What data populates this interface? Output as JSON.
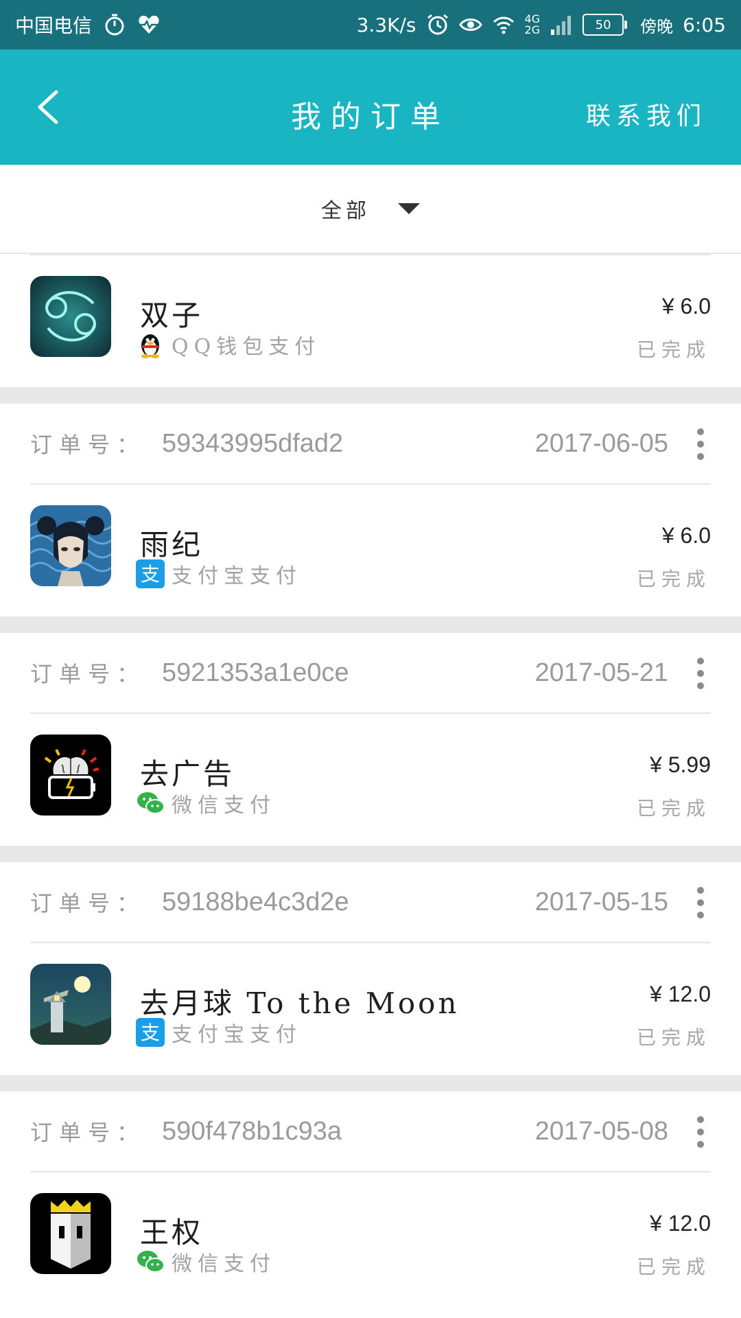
{
  "status_bar": {
    "carrier": "中国电信",
    "net_speed": "3.3K/s",
    "network_type_top": "4G",
    "network_type_bottom": "2G",
    "battery": "50",
    "time_prefix": "傍晚",
    "time": "6:05"
  },
  "app_bar": {
    "title": "我的订单",
    "contact_label": "联系我们"
  },
  "filter": {
    "label": "全部"
  },
  "order_number_label": "订单号：",
  "orders": [
    {
      "app_name": "双子",
      "payment_method": "QQ钱包支付",
      "price": "¥ 6.0",
      "status": "已完成",
      "icon": "twins-icon"
    },
    {
      "order_id": "59343995dfad2",
      "date": "2017-06-05",
      "app_name": "雨纪",
      "payment_method": "支付宝支付",
      "price": "¥ 6.0",
      "status": "已完成",
      "icon": "rain-icon"
    },
    {
      "order_id": "5921353a1e0ce",
      "date": "2017-05-21",
      "app_name": "去广告",
      "payment_method": "微信支付",
      "price": "¥ 5.99",
      "status": "已完成",
      "icon": "ad-remover-icon"
    },
    {
      "order_id": "59188be4c3d2e",
      "date": "2017-05-15",
      "app_name": "去月球 To the Moon",
      "payment_method": "支付宝支付",
      "price": "¥ 12.0",
      "status": "已完成",
      "icon": "moon-icon"
    },
    {
      "order_id": "590f478b1c93a",
      "date": "2017-05-08",
      "app_name": "王权",
      "payment_method": "微信支付",
      "price": "¥ 12.0",
      "status": "已完成",
      "icon": "crown-icon"
    }
  ],
  "colors": {
    "status_bar": "#17707c",
    "app_bar": "#1ab5c2",
    "separator": "#e8e8e8",
    "alipay": "#1a9ee6",
    "wechat": "#32b24a"
  }
}
